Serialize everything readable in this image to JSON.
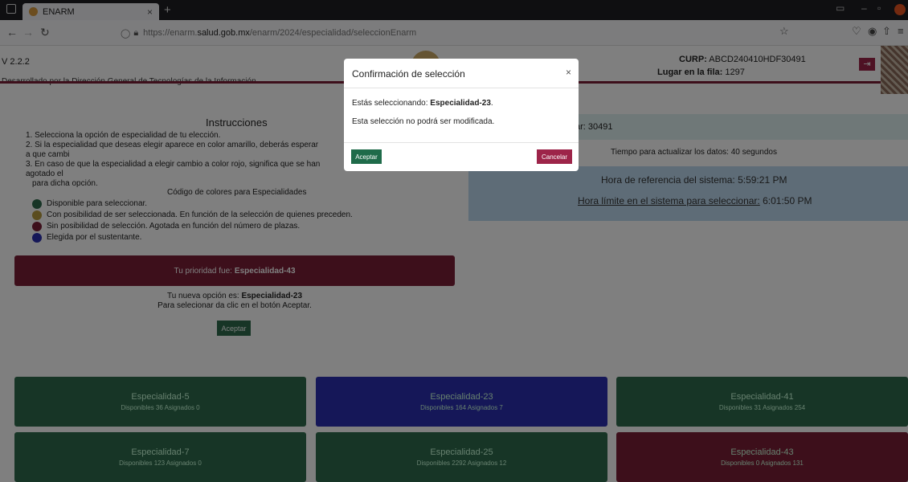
{
  "browser": {
    "tab_title": "ENARM",
    "url_prefix": "https://enarm.",
    "url_domain": "salud.gob.mx",
    "url_path": "/enarm/2024/especialidad/seleccionEnarm"
  },
  "header": {
    "version": "V 2.2.2",
    "developed_by": "Desarrollado por la Dirección General de Tecnologías de la Información",
    "curp_label": "CURP:",
    "curp_value": "ABCD240410HDF30491",
    "fila_label": "Lugar en la fila:",
    "fila_value": "1297"
  },
  "instructions": {
    "title": "Instrucciones",
    "items": [
      "1. Selecciona la opción de especialidad de tu elección.",
      "2. Si la especialidad que deseas elegir aparece en color amarillo, deberás esperar a que cambi",
      "3. En caso de que la especialidad a elegir cambio a color rojo, significa que se han agotado el",
      "para dicha opción."
    ],
    "color_code_title": "Código de colores para Especialidades",
    "legend": [
      {
        "color": "#2e6b4c",
        "label": "Disponible para seleccionar."
      },
      {
        "color": "#b79b3e",
        "label": "Con posibilidad de ser seleccionada. En función de la selección de quienes preceden."
      },
      {
        "color": "#7a1f37",
        "label": "Sin posibilidad de selección. Agotada en función del número de plazas."
      },
      {
        "color": "#2a2fb0",
        "label": "Elegida por el sustentante."
      }
    ]
  },
  "priority": {
    "label": "Tu prioridad fue:",
    "value": "Especialidad-43"
  },
  "new_option": {
    "label": "Tu nueva opción es:",
    "value": "Especialidad-23",
    "hint": "Para selecionar da clic en el botón Aceptar.",
    "button": "Aceptar"
  },
  "right": {
    "lugar_fragment": "ar: 30491",
    "tiempo": "Tiempo para actualizar los datos: 40 segundos",
    "hora_ref": "Hora de referencia del sistema: 5:59:21 PM",
    "hora_limite_label": "Hora límite en el sistema para seleccionar:",
    "hora_limite_value": "6:01:50 PM"
  },
  "cards": [
    {
      "name": "Especialidad-5",
      "info": "Disponibles 36 Asignados 0",
      "color": "#2e6b4c"
    },
    {
      "name": "Especialidad-23",
      "info": "Disponibles 164 Asignados 7",
      "color": "#2a2fb0"
    },
    {
      "name": "Especialidad-41",
      "info": "Disponibles 31 Asignados 254",
      "color": "#2e6b4c"
    },
    {
      "name": "Especialidad-7",
      "info": "Disponibles 123 Asignados 0",
      "color": "#2e6b4c"
    },
    {
      "name": "Especialidad-25",
      "info": "Disponibles 2292 Asignados 12",
      "color": "#2e6b4c"
    },
    {
      "name": "Especialidad-43",
      "info": "Disponibles 0 Asignados 131",
      "color": "#7a1f37"
    }
  ],
  "modal": {
    "title": "Confirmación de selección",
    "close": "×",
    "line1_prefix": "Estás seleccionando:",
    "line1_value": "Especialidad-23",
    "line1_suffix": ".",
    "line2": "Esta selección no podrá ser modificada.",
    "accept": "Aceptar",
    "cancel": "Cancelar"
  }
}
